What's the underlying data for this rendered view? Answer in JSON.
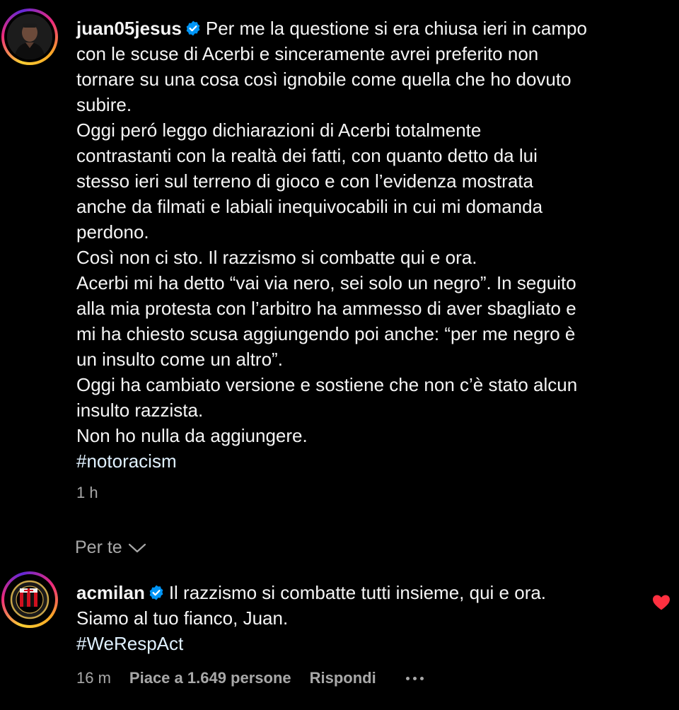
{
  "post": {
    "username": "juan05jesus",
    "verified": true,
    "lines": [
      "Per me la questione si era chiusa ieri in campo",
      "con le scuse di Acerbi e sinceramente avrei preferito non",
      "tornare su una cosa così ignobile come quella che ho dovuto",
      "subire.",
      "Oggi peró leggo dichiarazioni di Acerbi totalmente",
      "contrastanti con la realtà dei fatti, con quanto detto da lui",
      "stesso ieri sul terreno di gioco e con l’evidenza mostrata",
      "anche da filmati e labiali inequivocabili in cui mi domanda",
      "perdono.",
      "Così non ci sto. Il razzismo si combatte qui e ora.",
      "Acerbi mi ha detto “vai via nero, sei solo un negro”. In seguito",
      "alla mia protesta con l’arbitro ha ammesso di aver sbagliato e",
      "mi ha chiesto scusa aggiungendo poi anche: “per me negro è",
      "un insulto come un altro”.",
      "Oggi ha cambiato versione e sostiene che non c’è stato alcun",
      "insulto razzista.",
      "Non ho nulla da aggiungere."
    ],
    "hashtag": "#notoracism",
    "time": "1 h"
  },
  "section": {
    "label": "Per te",
    "icon": "chevron-down-icon"
  },
  "reply": {
    "username": "acmilan",
    "verified": true,
    "lines": [
      "Il razzismo si combatte tutti insieme, qui e ora.",
      "Siamo al tuo fianco, Juan."
    ],
    "hashtag": "#WeRespAct",
    "time": "16 m",
    "likes": "Piace a 1.649 persone",
    "reply_label": "Rispondi",
    "more_icon": "more-options-icon",
    "liked": true,
    "heart_icon": "heart-icon"
  },
  "colors": {
    "background": "#000000",
    "text": "#f5f5f5",
    "secondary": "#a8a8a8",
    "verified": "#0095f6",
    "heart": "#ff3040",
    "hashtag": "#e0f1ff"
  }
}
